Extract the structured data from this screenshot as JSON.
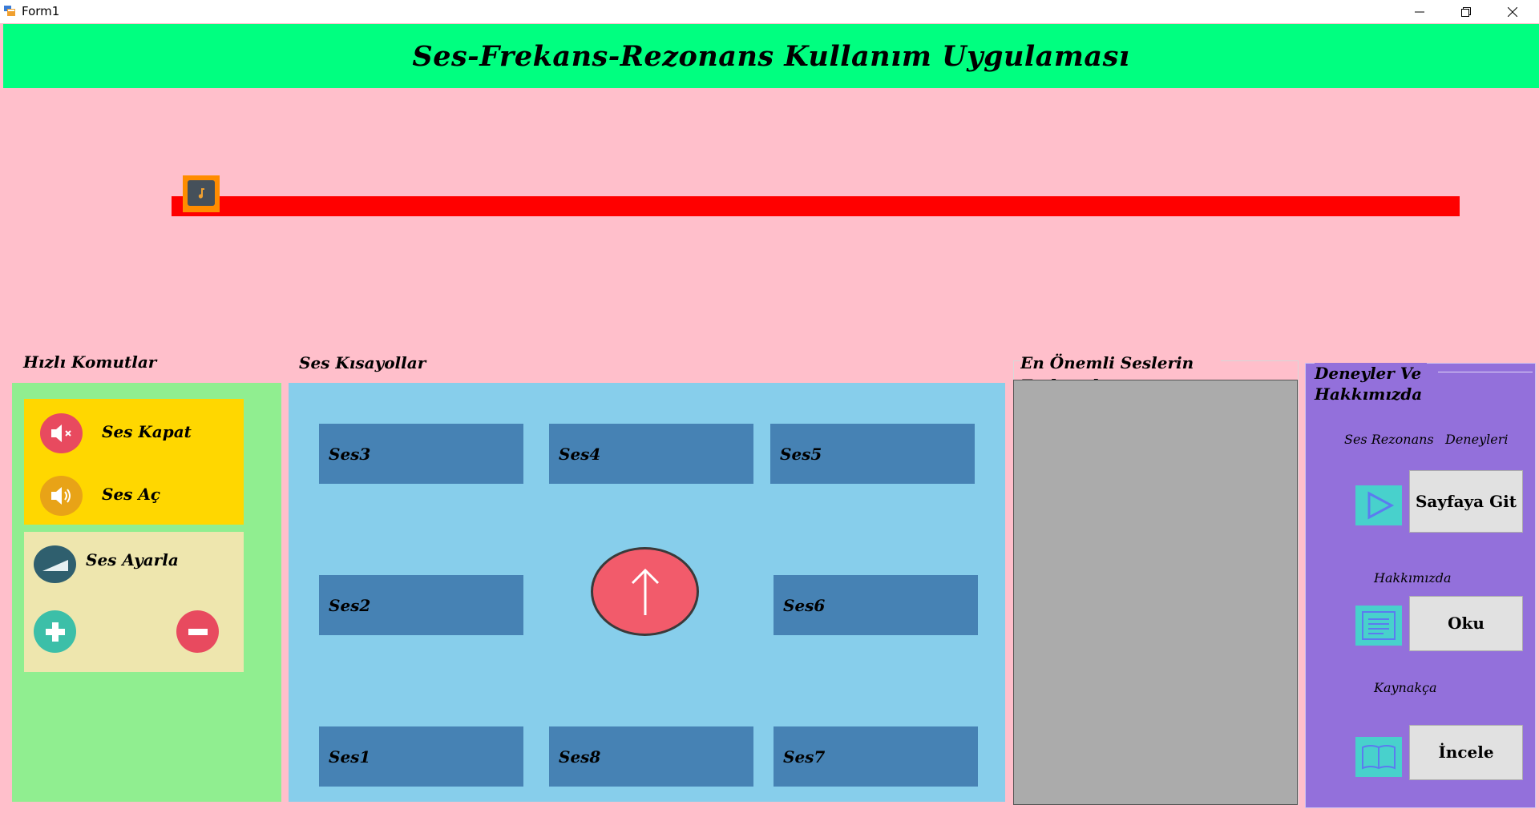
{
  "window": {
    "title": "Form1"
  },
  "header": {
    "title": "Ses-Frekans-Rezonans Kullanım Uygulaması"
  },
  "slider": {
    "value_fraction": 0.0
  },
  "quick_commands": {
    "label": "Hızlı Komutlar",
    "mute_label": "Ses Kapat",
    "unmute_label": "Ses Aç",
    "adjust_label": "Ses Ayarla"
  },
  "shortcuts": {
    "label": "Ses Kısayollar",
    "buttons": [
      "Ses3",
      "Ses4",
      "Ses5",
      "Ses2",
      "Ses6",
      "Ses1",
      "Ses8",
      "Ses7"
    ]
  },
  "important_sounds": {
    "label": "En Önemli Seslerin Frekansları"
  },
  "experiments": {
    "title_line1": "Deneyler Ve",
    "title_line2": "Hakkımızda",
    "label_ses_rezonans": "Ses Rezonans",
    "label_deneyleri": "Deneyleri",
    "go_button": "Sayfaya Git",
    "label_hakkimizda": "Hakkımızda",
    "read_button": "Oku",
    "label_kaynakca": "Kaynakça",
    "review_button": "İncele"
  },
  "colors": {
    "background": "#ffbfcb",
    "header": "#00ff80",
    "slider_track": "#ff0000",
    "quick_panel": "#90ee90",
    "shortcut_panel": "#87ceeb",
    "shortcut_button": "#4682b4",
    "list_box": "#ababab",
    "experiments_panel": "#9370db"
  }
}
